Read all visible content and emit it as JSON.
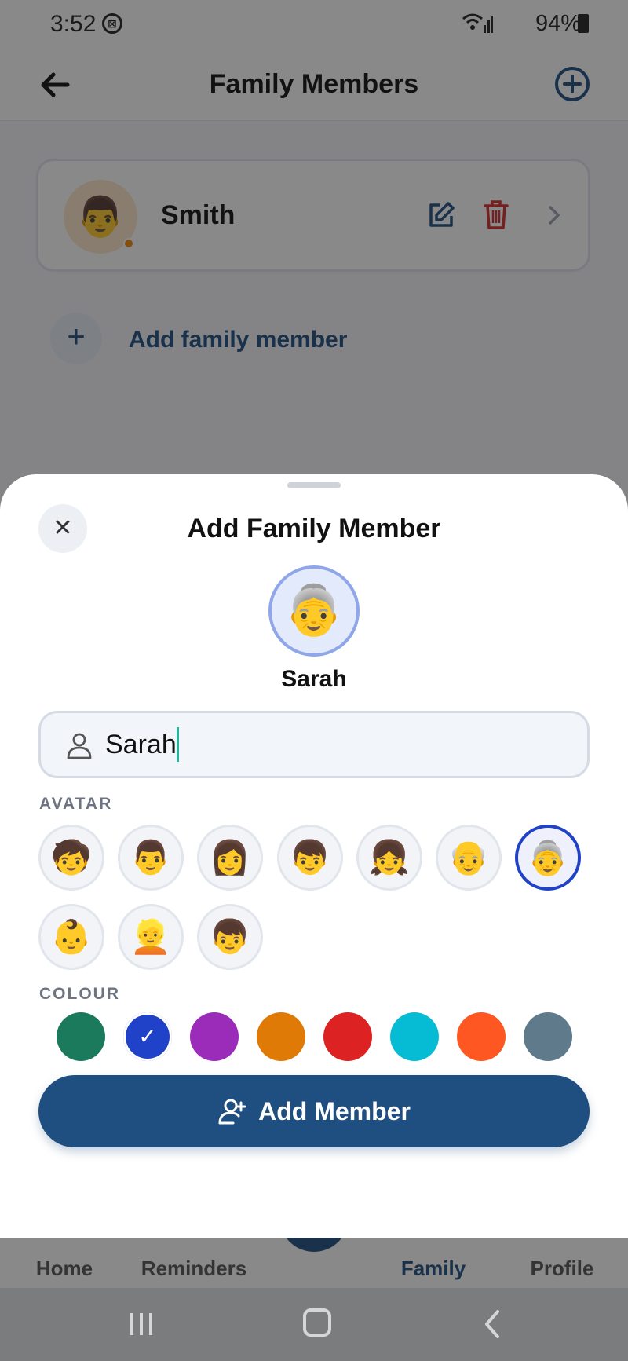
{
  "status_bar": {
    "time": "3:52",
    "battery": "94%"
  },
  "app_bar": {
    "title": "Family Members"
  },
  "member_card": {
    "avatar": "👨",
    "name": "Smith",
    "dot_color": "#f08a0a"
  },
  "add_family": {
    "label": "Add family member",
    "icon": "+"
  },
  "bottom_nav": {
    "items": [
      {
        "label": "Home",
        "active": false
      },
      {
        "label": "Reminders",
        "active": false
      },
      {
        "label": "Family",
        "active": true
      },
      {
        "label": "Profile",
        "active": false
      }
    ]
  },
  "sheet": {
    "title": "Add Family Member",
    "close_icon": "✕",
    "preview": {
      "avatar": "👵",
      "name": "Sarah"
    },
    "name_field": {
      "value": "Sarah",
      "icon": "person-icon"
    },
    "avatar_section_label": "AVATAR",
    "avatars": [
      {
        "emoji": "🧒",
        "selected": false
      },
      {
        "emoji": "👨",
        "selected": false
      },
      {
        "emoji": "👩",
        "selected": false
      },
      {
        "emoji": "👦",
        "selected": false
      },
      {
        "emoji": "👧",
        "selected": false
      },
      {
        "emoji": "👴",
        "selected": false
      },
      {
        "emoji": "👵",
        "selected": true
      },
      {
        "emoji": "👶",
        "selected": false
      },
      {
        "emoji": "👱",
        "selected": false
      },
      {
        "emoji": "👦",
        "selected": false
      }
    ],
    "colour_section_label": "COLOUR",
    "colours": [
      {
        "hex": "#1b7a5c",
        "selected": false
      },
      {
        "hex": "#2042c8",
        "selected": true,
        "mark": "✓"
      },
      {
        "hex": "#9b2cba",
        "selected": false
      },
      {
        "hex": "#de7a05",
        "selected": false
      },
      {
        "hex": "#dd2224",
        "selected": false
      },
      {
        "hex": "#06bcd4",
        "selected": false
      },
      {
        "hex": "#fe5721",
        "selected": false
      },
      {
        "hex": "#5e7a8b",
        "selected": false
      }
    ],
    "submit_label": "Add Member"
  }
}
